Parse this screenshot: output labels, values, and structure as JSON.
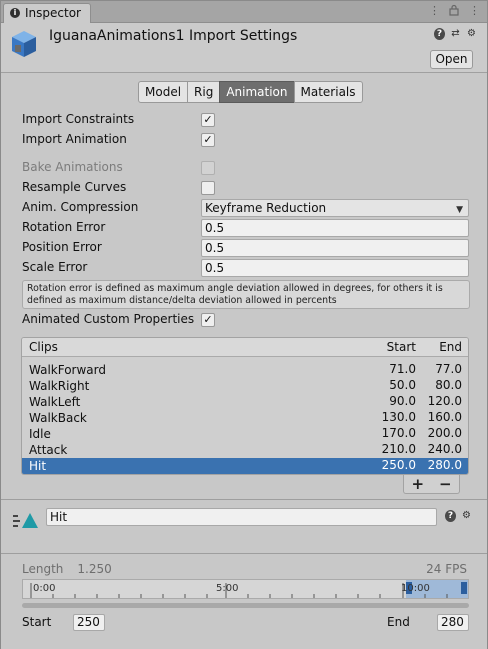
{
  "window": {
    "tab_label": "Inspector",
    "tab_icon": "info-icon",
    "tab_tools": [
      "more-icon",
      "lock-icon",
      "menu-icon"
    ]
  },
  "header": {
    "title": "IguanaAnimations1 Import Settings",
    "open_label": "Open",
    "icons": [
      "help-icon",
      "presets-icon",
      "settings-icon"
    ]
  },
  "tabs": [
    {
      "label": "Model",
      "active": false
    },
    {
      "label": "Rig",
      "active": false
    },
    {
      "label": "Animation",
      "active": true
    },
    {
      "label": "Materials",
      "active": false
    }
  ],
  "settings": {
    "import_constraints": {
      "label": "Import Constraints",
      "checked": true
    },
    "import_animation": {
      "label": "Import Animation",
      "checked": true
    },
    "bake_animations": {
      "label": "Bake Animations",
      "checked": false,
      "disabled": true
    },
    "resample_curves": {
      "label": "Resample Curves",
      "checked": false
    },
    "anim_compression": {
      "label": "Anim. Compression",
      "value": "Keyframe Reduction"
    },
    "rotation_error": {
      "label": "Rotation Error",
      "value": "0.5"
    },
    "position_error": {
      "label": "Position Error",
      "value": "0.5"
    },
    "scale_error": {
      "label": "Scale Error",
      "value": "0.5"
    },
    "help_text_line1": "Rotation error is defined as maximum angle deviation allowed in degrees, for others it is",
    "help_text_line2": "defined as maximum distance/delta deviation allowed in percents",
    "animated_custom_properties": {
      "label": "Animated Custom Properties",
      "checked": true
    }
  },
  "clips": {
    "headers": {
      "name": "Clips",
      "start": "Start",
      "end": "End"
    },
    "rows": [
      {
        "name": "WalkForward",
        "start": "71.0",
        "end": "77.0",
        "selected": false
      },
      {
        "name": "WalkRight",
        "start": "50.0",
        "end": "80.0",
        "selected": false
      },
      {
        "name": "WalkLeft",
        "start": "90.0",
        "end": "120.0",
        "selected": false
      },
      {
        "name": "WalkBack",
        "start": "130.0",
        "end": "160.0",
        "selected": false
      },
      {
        "name": "Idle",
        "start": "170.0",
        "end": "200.0",
        "selected": false
      },
      {
        "name": "Attack",
        "start": "210.0",
        "end": "240.0",
        "selected": false
      },
      {
        "name": "Hit",
        "start": "250.0",
        "end": "280.0",
        "selected": true
      }
    ],
    "add_label": "+",
    "remove_label": "−"
  },
  "clip_detail": {
    "name": "Hit",
    "length_label": "Length",
    "length_value": "1.250",
    "fps": "24 FPS",
    "timeline_labels": [
      "0:00",
      "5:00",
      "10:00"
    ],
    "start_label": "Start",
    "start_value": "250",
    "end_label": "End",
    "end_value": "280"
  },
  "colors": {
    "selection": "#3a72b0",
    "active_tab": "#6e6e6e",
    "timeline_highlight": "#9fb9d8"
  }
}
